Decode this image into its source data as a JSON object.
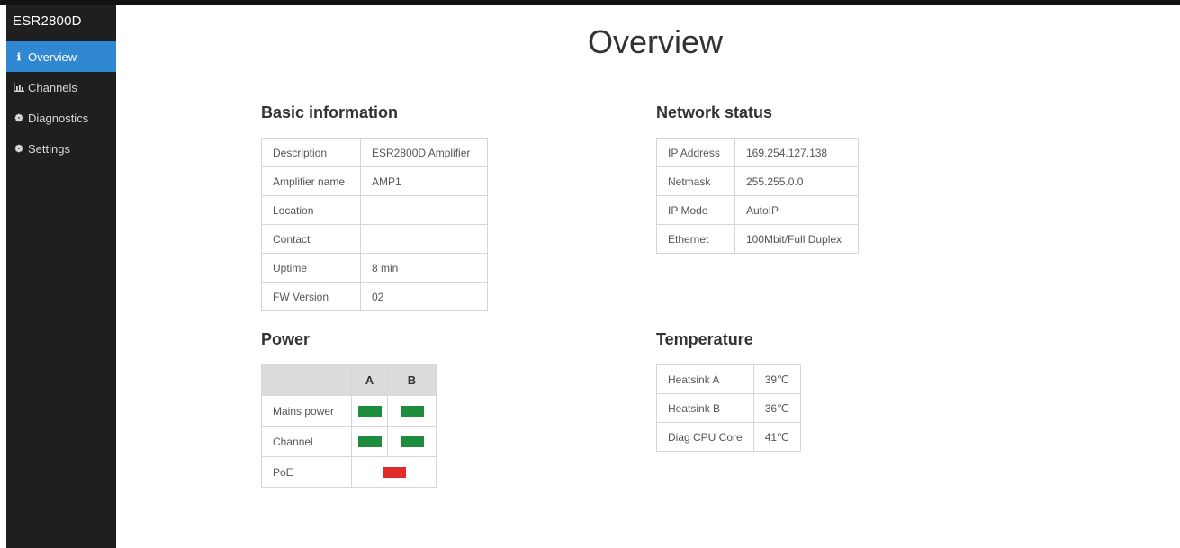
{
  "app": {
    "brand": "ESR2800D"
  },
  "sidebar": {
    "items": [
      {
        "label": "Overview",
        "icon": "info-icon",
        "active": true
      },
      {
        "label": "Channels",
        "icon": "bar-chart-icon",
        "active": false
      },
      {
        "label": "Diagnostics",
        "icon": "gear-icon",
        "active": false
      },
      {
        "label": "Settings",
        "icon": "gear-icon",
        "active": false
      }
    ]
  },
  "page": {
    "title": "Overview"
  },
  "basic_information": {
    "heading": "Basic information",
    "rows": [
      {
        "label": "Description",
        "value": "ESR2800D Amplifier"
      },
      {
        "label": "Amplifier name",
        "value": "AMP1"
      },
      {
        "label": "Location",
        "value": ""
      },
      {
        "label": "Contact",
        "value": ""
      },
      {
        "label": "Uptime",
        "value": "8 min"
      },
      {
        "label": "FW Version",
        "value": "02"
      }
    ]
  },
  "network_status": {
    "heading": "Network status",
    "rows": [
      {
        "label": "IP Address",
        "value": "169.254.127.138"
      },
      {
        "label": "Netmask",
        "value": "255.255.0.0"
      },
      {
        "label": "IP Mode",
        "value": "AutoIP"
      },
      {
        "label": "Ethernet",
        "value": "100Mbit/Full Duplex"
      }
    ]
  },
  "power": {
    "heading": "Power",
    "columns": [
      "A",
      "B"
    ],
    "rows": [
      {
        "label": "Mains power",
        "status": [
          "ok",
          "ok"
        ]
      },
      {
        "label": "Channel",
        "status": [
          "ok",
          "ok"
        ]
      },
      {
        "label": "PoE",
        "status": [
          "fault"
        ]
      }
    ],
    "colors": {
      "ok": "#1e8e3e",
      "fault": "#e02b2b"
    }
  },
  "temperature": {
    "heading": "Temperature",
    "rows": [
      {
        "label": "Heatsink A",
        "value": "39℃"
      },
      {
        "label": "Heatsink B",
        "value": "36℃"
      },
      {
        "label": "Diag CPU Core",
        "value": "41℃"
      }
    ]
  },
  "colors": {
    "sidebar_bg": "#1f1f1f",
    "active_nav": "#2f88d1"
  }
}
